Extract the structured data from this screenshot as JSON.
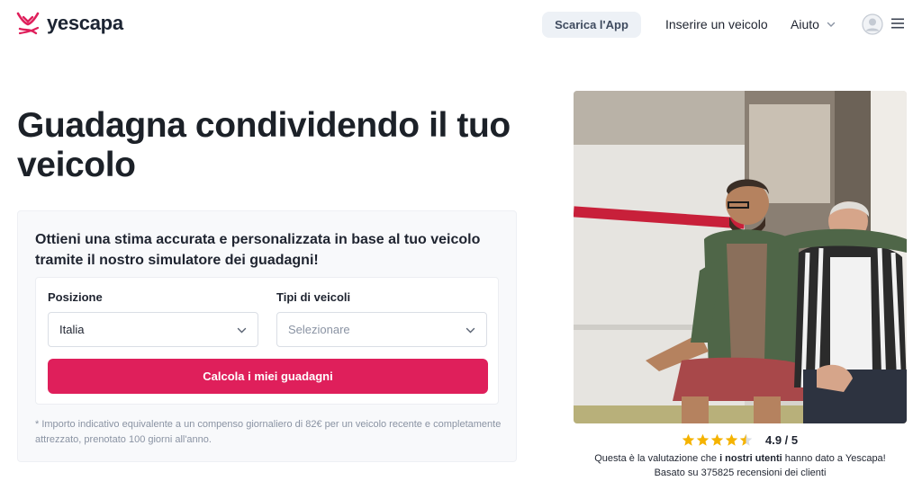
{
  "header": {
    "brand": "yescapa",
    "download_app": "Scarica l'App",
    "add_vehicle": "Inserire un veicolo",
    "help": "Aiuto"
  },
  "hero": {
    "title": "Guadagna condividendo il tuo veicolo"
  },
  "estimator": {
    "heading": "Ottieni una stima accurata e personalizzata in base al tuo veicolo tramite il nostro simulatore dei guadagni!",
    "position_label": "Posizione",
    "position_value": "Italia",
    "vehicle_type_label": "Tipi di veicoli",
    "vehicle_type_placeholder": "Selezionare",
    "submit_label": "Calcola i miei guadagni",
    "footnote": "* Importo indicativo equivalente a un compenso giornaliero di 82€ per un veicolo recente e completamente attrezzato, prenotato 100 giorni all'anno."
  },
  "rating": {
    "stars": 4.5,
    "score": "4.9 / 5",
    "line1_prefix": "Questa è la valutazione che ",
    "line1_bold": "i nostri utenti",
    "line1_suffix": " hanno dato a Yescapa!",
    "line2": "Basato su 375825 recensioni dei clienti"
  },
  "colors": {
    "brand": "#df1f5b",
    "star": "#f5b300"
  }
}
